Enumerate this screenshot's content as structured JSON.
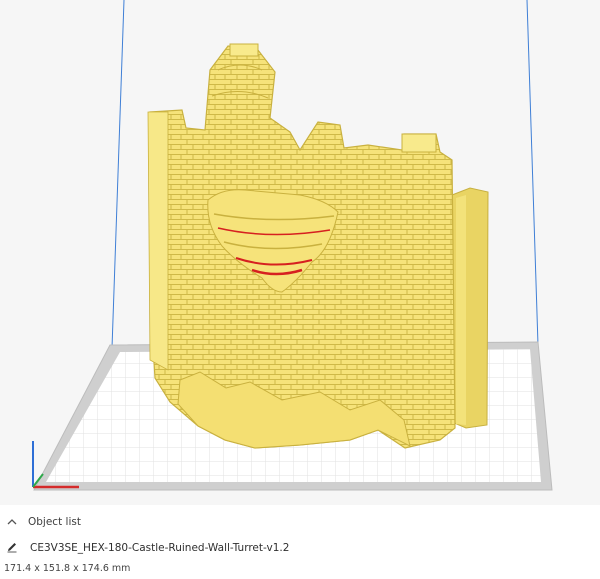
{
  "object_list": {
    "toggle_icon": "chevron-up-icon",
    "label": "Object list"
  },
  "model": {
    "edit_icon": "pencil-icon",
    "filename": "CE3V3SE_HEX-180-Castle-Ruined-Wall-Turret-v1.2",
    "dimensions": "171.4 x 151.8 x 174.6 mm"
  },
  "colors": {
    "model_fill": "#f6e37a",
    "model_shadow": "#e6cf5a",
    "overhang": "#d62020",
    "build_plate": "#c8c8c8",
    "grid_line": "#e6e6e6",
    "build_volume_edge": "#3f7fd6",
    "axis_x": "#d42a2a",
    "axis_y": "#2ea84a",
    "axis_z": "#2e6fd6"
  }
}
